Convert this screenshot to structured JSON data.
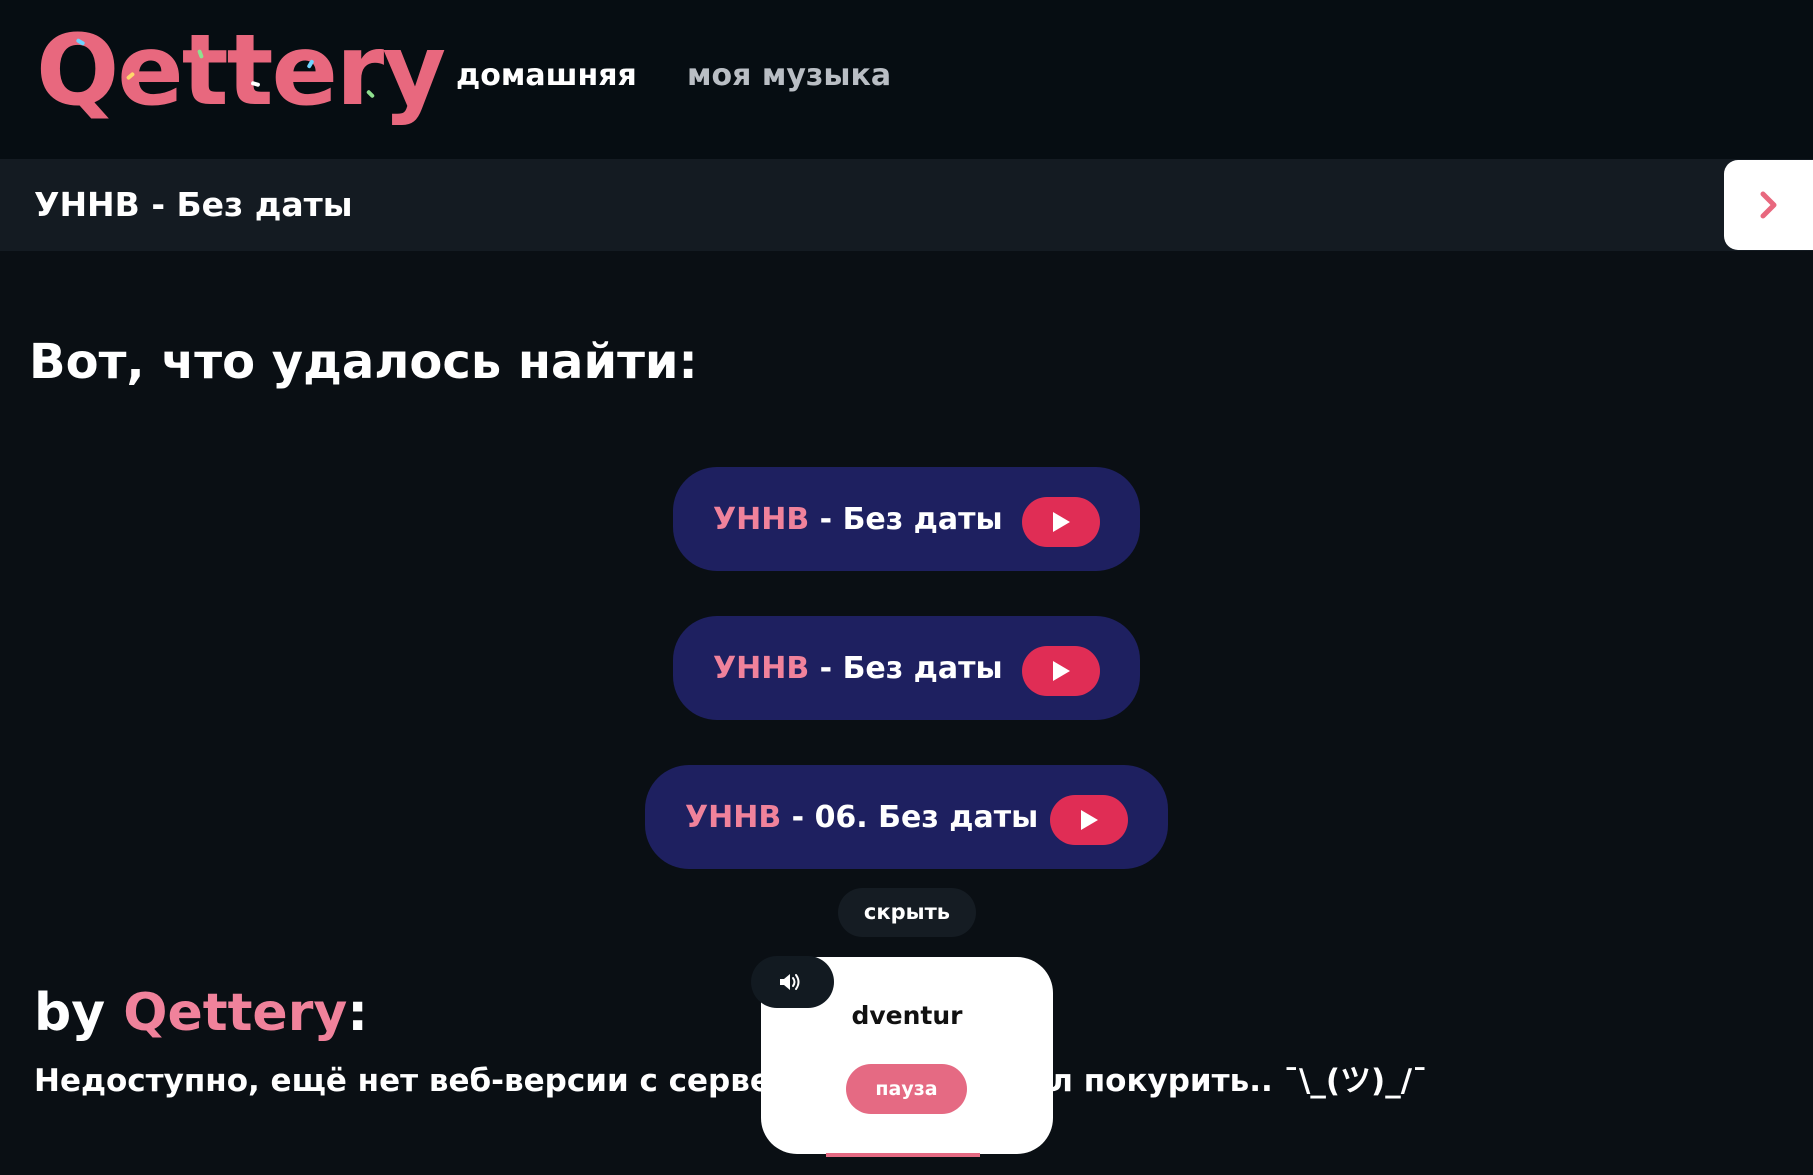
{
  "header": {
    "logo": "Qettery",
    "nav": [
      {
        "label": "домашняя",
        "active": true
      },
      {
        "label": "моя музыка",
        "active": false
      }
    ]
  },
  "now_playing": {
    "title": "УННВ - Без даты",
    "next_icon": "chevron-right-icon"
  },
  "results": {
    "heading": "Вот, что удалось найти:",
    "items": [
      {
        "artist": "УННВ",
        "separator": " - ",
        "track": "Без даты"
      },
      {
        "artist": "УННВ",
        "separator": " - ",
        "track": "Без даты"
      },
      {
        "artist": "УННВ",
        "separator": " - ",
        "track": "06. Без даты"
      }
    ],
    "hide_label": "скрыть"
  },
  "by_section": {
    "prefix": "by ",
    "brand": "Qettery",
    "suffix": ":",
    "message": "Недоступно, ещё нет веб-версии с сервером...вер вышел покурить.. ¯\\_(ツ)_/¯"
  },
  "player": {
    "name": "dventur",
    "pause_label": "пауза",
    "volume_icon": "volume-icon"
  },
  "colors": {
    "background": "#0a0f14",
    "accent": "#e02d55",
    "brand_pink": "#f0829b",
    "card": "#1e2060"
  }
}
